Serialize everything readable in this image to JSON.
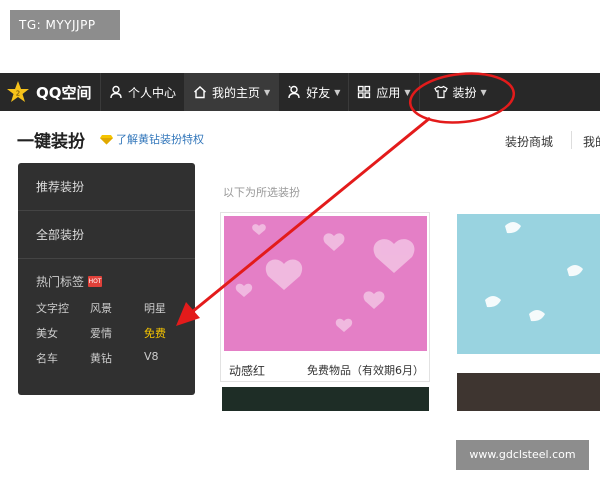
{
  "watermark_top": "TG: MYYJJPP",
  "watermark_bottom": "www.gdclsteel.com",
  "navbar": {
    "logo_text": "QQ空间",
    "items": [
      {
        "label": "个人中心",
        "icon": "user-icon"
      },
      {
        "label": "我的主页",
        "icon": "home-icon"
      },
      {
        "label": "好友",
        "icon": "friends-icon"
      },
      {
        "label": "应用",
        "icon": "apps-grid-icon"
      },
      {
        "label": "装扮",
        "icon": "tshirt-icon"
      }
    ]
  },
  "header": {
    "title": "一键装扮",
    "vip_link": "了解黄钻装扮特权",
    "shop_link": "装扮商城",
    "my_link": "我的"
  },
  "sidebar": {
    "recommended": "推荐装扮",
    "all": "全部装扮",
    "hot_tags_title": "热门标签",
    "hot_badge": "HOT",
    "tags": [
      "文字控",
      "风景",
      "明星",
      "美女",
      "爱情",
      "免费",
      "名车",
      "黄钻",
      "V8"
    ],
    "selected_tag": "免费"
  },
  "main": {
    "caption": "以下为所选装扮",
    "card": {
      "name": "动感红",
      "meta": "免费物品（有效期6月）"
    }
  },
  "colors": {
    "navbar_bg": "#282828",
    "sidebar_bg": "#303030",
    "card_pink": "#e47fc6",
    "card_blue": "#99d3e0",
    "selected_tag": "#f5c400",
    "link_blue": "#3377bb",
    "annotation_red": "#e31b1b"
  }
}
